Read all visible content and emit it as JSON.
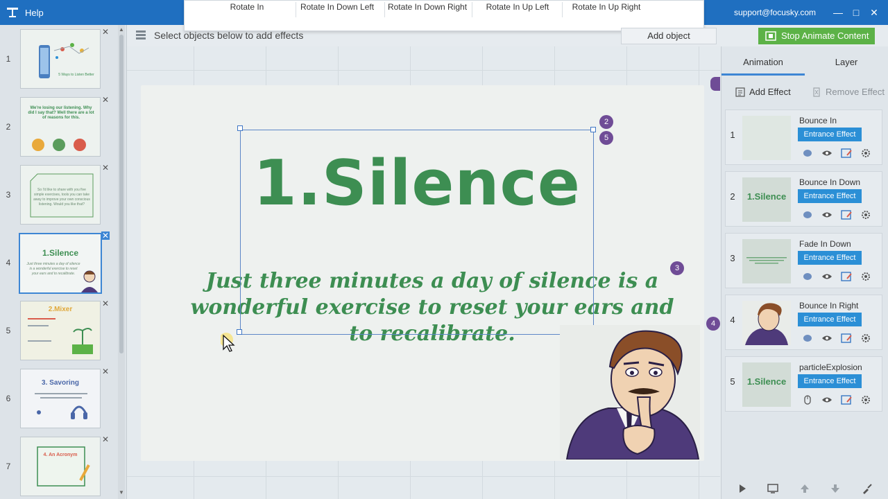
{
  "topbar": {
    "help_label": "Help",
    "support_email": "support@focusky.com",
    "icons": [
      "help-icon",
      "minimize-icon",
      "maximize-icon",
      "close-icon"
    ]
  },
  "effect_strip": {
    "options": [
      "Rotate In",
      "Rotate In Down Left",
      "Rotate In Down Right",
      "Rotate In Up Left",
      "Rotate In Up Right"
    ]
  },
  "toolbar": {
    "hint": "Select objects below to add effects",
    "add_object_label": "Add object",
    "stop_label": "Stop Animate Content"
  },
  "slides": [
    {
      "number": "1",
      "title": "",
      "text": "5 Ways to Listen Better"
    },
    {
      "number": "2",
      "title": "",
      "text": "We're losing our listening. Why did I say that? Well there are a lot of reasons for this."
    },
    {
      "number": "3",
      "title": "",
      "text": "So I'd like to share with you five simple exercises, tools you can take away to improve your own conscious listening. Would you like that?"
    },
    {
      "number": "4",
      "title": "1.Silence",
      "text": "Just three minutes a day of silence is a wonderful exercise to reset your ears and to recalibrate."
    },
    {
      "number": "5",
      "title": "2.Mixer",
      "text": ""
    },
    {
      "number": "6",
      "title": "3. Savoring",
      "text": ""
    },
    {
      "number": "7",
      "title": "4. An Acronym",
      "text": ""
    }
  ],
  "canvas": {
    "title": "1.Silence",
    "quote": "Just three minutes a day of silence is a wonderful exercise to reset your ears and to recalibrate.",
    "badges": [
      "2",
      "5",
      "3",
      "4"
    ],
    "accent_green": "#3d8e52",
    "badge_color": "#6f4c96"
  },
  "right_panel": {
    "tabs": [
      "Animation",
      "Layer"
    ],
    "add_effect_label": "Add Effect",
    "remove_effect_label": "Remove Effect",
    "effects": [
      {
        "number": "1",
        "name": "Bounce In",
        "type": "Entrance Effect",
        "thumb_label": ""
      },
      {
        "number": "2",
        "name": "Bounce In Down",
        "type": "Entrance Effect",
        "thumb_label": "1.Silence"
      },
      {
        "number": "3",
        "name": "Fade In Down",
        "type": "Entrance Effect",
        "thumb_label": ""
      },
      {
        "number": "4",
        "name": "Bounce In Right",
        "type": "Entrance Effect",
        "thumb_label": ""
      },
      {
        "number": "5",
        "name": "particleExplosion",
        "type": "Entrance Effect",
        "thumb_label": "1.Silence"
      }
    ],
    "accent_blue": "#2b8fd6"
  }
}
